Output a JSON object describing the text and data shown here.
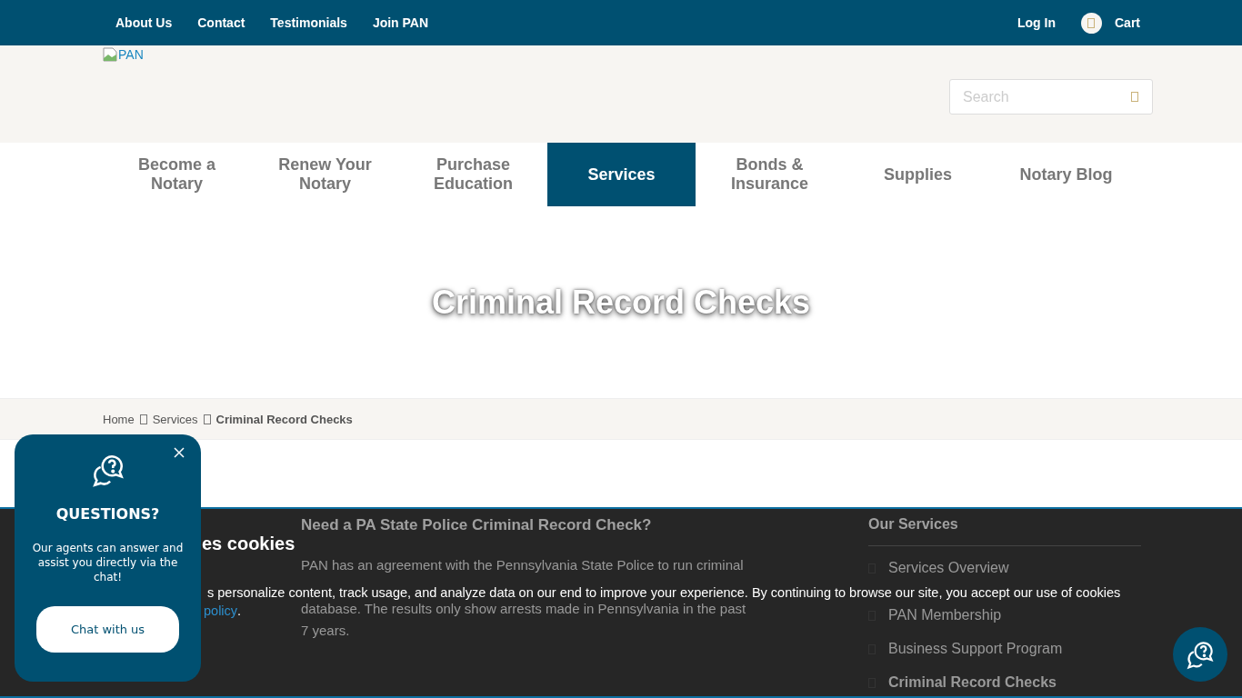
{
  "top_bar": {
    "links": [
      "About Us",
      "Contact",
      "Testimonials",
      "Join PAN"
    ],
    "login": "Log In",
    "cart": "Cart"
  },
  "header": {
    "logo_alt": "PAN",
    "search": {
      "placeholder": "Search"
    }
  },
  "nav": [
    {
      "label": "Become a Notary",
      "selected": false
    },
    {
      "label": "Renew Your Notary",
      "selected": false
    },
    {
      "label": "Purchase Education",
      "selected": false
    },
    {
      "label": "Services",
      "selected": true
    },
    {
      "label": "Bonds & Insurance",
      "selected": false
    },
    {
      "label": "Supplies",
      "selected": false
    },
    {
      "label": "Notary Blog",
      "selected": false
    }
  ],
  "hero": {
    "title": "Criminal Record Checks"
  },
  "breadcrumb": [
    {
      "label": "Home",
      "current": false
    },
    {
      "label": "Services",
      "current": false
    },
    {
      "label": "Criminal Record Checks",
      "current": true
    }
  ],
  "article": {
    "heading": "Need a PA State Police Criminal Record Check?",
    "lines": [
      "PAN has an agreement with the Pennsylvania State Police to run criminal",
      "database. The results only show arrests made in Pennsylvania in the past",
      "7 years."
    ]
  },
  "sidebar": {
    "title": "Our Services",
    "items": [
      {
        "label": "Services Overview",
        "selected": false
      },
      {
        "label": "PAN Membership",
        "selected": false
      },
      {
        "label": "Business Support Program",
        "selected": false
      },
      {
        "label": "Criminal Record Checks",
        "selected": true
      }
    ]
  },
  "cookie_banner": {
    "title": "es cookies",
    "text": "s personalize content, track usage, and analyze data on our end to improve your experience. By continuing to browse our site, you accept our use of cookies",
    "link": "policy",
    "after_link": "."
  },
  "chat_popup": {
    "title": "QUESTIONS?",
    "text": "Our agents can answer and assist you directly via the chat!",
    "button": "Chat with us"
  }
}
